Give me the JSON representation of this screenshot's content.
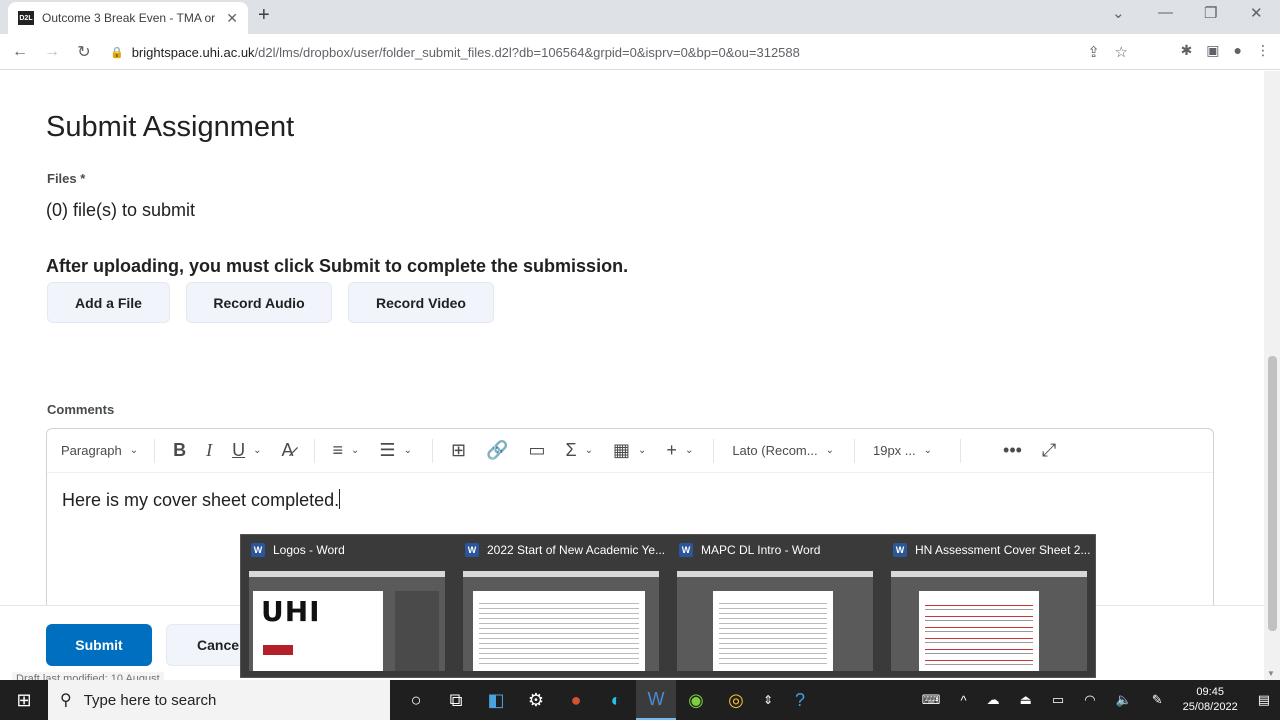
{
  "browser": {
    "tab_title": "Outcome 3 Break Even - TMA or",
    "favicon_text": "D2L",
    "url_domain": "brightspace.uhi.ac.uk",
    "url_path": "/d2l/lms/dropbox/user/folder_submit_files.d2l?db=106564&grpid=0&isprv=0&bp=0&ou=312588"
  },
  "page": {
    "title": "Submit Assignment",
    "files_label": "Files",
    "files_required_mark": "*",
    "files_count": "(0) file(s) to submit",
    "notice": "After uploading, you must click Submit to complete the submission.",
    "buttons": {
      "add_file": "Add a File",
      "record_audio": "Record Audio",
      "record_video": "Record Video"
    },
    "comments_label": "Comments"
  },
  "editor": {
    "paragraph": "Paragraph",
    "font": "Lato (Recom...",
    "size": "19px ...",
    "content": "Here is my cover sheet completed."
  },
  "footer": {
    "submit": "Submit",
    "cancel": "Cancel",
    "draft_note": "Draft last modified: 10 August"
  },
  "thumbnails": [
    {
      "title": "Logos - Word"
    },
    {
      "title": "2022 Start of New Academic Ye..."
    },
    {
      "title": "MAPC DL Intro - Word"
    },
    {
      "title": "HN Assessment Cover Sheet 2..."
    }
  ],
  "thumb_logo_text": "UHI",
  "taskbar": {
    "search_placeholder": "Type here to search",
    "time": "09:45",
    "date": "25/08/2022"
  },
  "colors": {
    "primary": "#006fbf",
    "button_bg": "#f1f5fb",
    "taskbar": "#1f1f1f",
    "word": "#2b579a"
  }
}
